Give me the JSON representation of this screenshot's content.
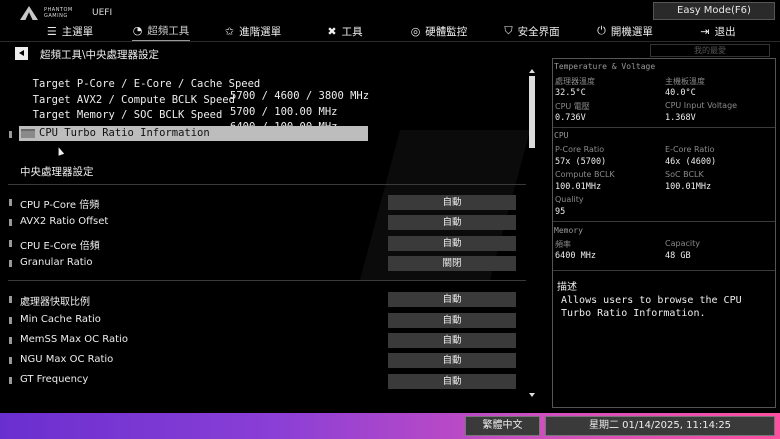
{
  "header": {
    "brand_line1": "PHANTOM",
    "brand_line2": "GAMING",
    "uefi": "UEFI",
    "easy_mode": "Easy Mode(F6)"
  },
  "nav": {
    "tabs": [
      {
        "label": "主選單",
        "icon": "list-icon"
      },
      {
        "label": "超頻工具",
        "icon": "speedometer-icon",
        "active": true
      },
      {
        "label": "進階選單",
        "icon": "star-icon"
      },
      {
        "label": "工具",
        "icon": "tools-icon"
      },
      {
        "label": "硬體監控",
        "icon": "monitor-icon"
      },
      {
        "label": "安全界面",
        "icon": "shield-icon"
      },
      {
        "label": "開機選單",
        "icon": "power-icon"
      },
      {
        "label": "退出",
        "icon": "exit-icon"
      }
    ]
  },
  "breadcrumb": "超頻工具\\中央處理器設定",
  "favorites": "我的最愛",
  "info": [
    {
      "label": "Target P-Core / E-Core / Cache Speed",
      "value": "5700 / 4600 / 3800 MHz"
    },
    {
      "label": "Target AVX2 / Compute BCLK Speed",
      "value": "5700 / 100.00 MHz"
    },
    {
      "label": "Target Memory / SOC BCLK Speed",
      "value": "6400 / 100.00 MHz"
    }
  ],
  "selected_item": "CPU Turbo Ratio Information",
  "section_title": "中央處理器設定",
  "options": [
    {
      "label": "CPU P-Core 倍頻",
      "value": "自動"
    },
    {
      "label": "AVX2 Ratio Offset",
      "value": "自動"
    },
    {
      "label": "CPU E-Core 倍頻",
      "value": "自動"
    },
    {
      "label": "Granular Ratio",
      "value": "關閉"
    },
    {
      "label": "處理器快取比例",
      "value": "自動"
    },
    {
      "label": "Min Cache  Ratio",
      "value": "自動"
    },
    {
      "label": "MemSS Max OC Ratio",
      "value": "自動"
    },
    {
      "label": "NGU Max OC Ratio",
      "value": "自動"
    },
    {
      "label": "GT Frequency",
      "value": "自動"
    }
  ],
  "panel": {
    "temp_header": "Temperature & Voltage",
    "cpu_temp_label": "處理器溫度",
    "cpu_temp": "32.5°C",
    "mb_temp_label": "主機板溫度",
    "mb_temp": "40.0°C",
    "cpu_volt_label": "CPU 電壓",
    "cpu_volt": "0.736V",
    "cpu_input_label": "CPU Input Voltage",
    "cpu_input": "1.368V",
    "cpu_header": "CPU",
    "pcore_label": "P-Core Ratio",
    "pcore": "57x (5700)",
    "ecore_label": "E-Core Ratio",
    "ecore": "46x (4600)",
    "compute_label": "Compute BCLK",
    "compute": "100.01MHz",
    "soc_label": "SoC BCLK",
    "soc": "100.01MHz",
    "quality_label": "Quality",
    "quality": "95",
    "mem_header": "Memory",
    "freq_label": "頻率",
    "freq": "6400 MHz",
    "cap_label": "Capacity",
    "cap": "48 GB",
    "desc_title": "描述",
    "desc_text": "Allows users to browse the CPU Turbo Ratio Information."
  },
  "footer": {
    "language": "繁體中文",
    "datetime": "星期二 01/14/2025, 11:14:25"
  },
  "colors": {
    "accent_start": "#6a2fcf",
    "accent_end": "#ff4fa0"
  }
}
